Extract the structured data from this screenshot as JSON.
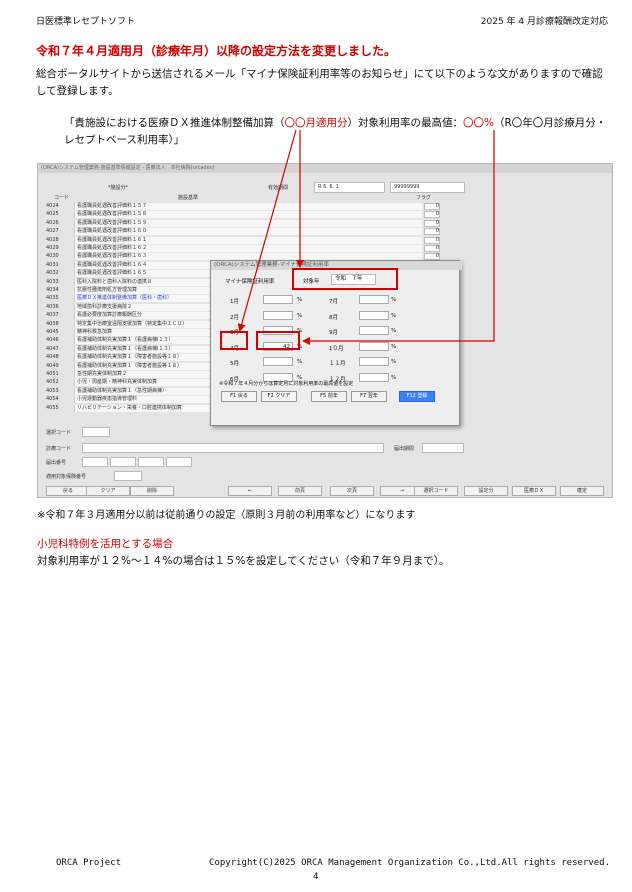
{
  "header": {
    "left": "日医標準レセプトソフト",
    "right": "2025 年 4 月診療報酬改定対応"
  },
  "heading": "令和７年４月適用月（診療年月）以降の設定方法を変更しました。",
  "intro": "総合ポータルサイトから送信されるメール「マイナ保険証利用率等のお知らせ」にて以下のような文がありますので確認して登録します。",
  "quote": {
    "part1": "「貴施設における医療ＤＸ推進体制整備加算（",
    "part2": "〇〇月適用分",
    "part3": "）対象利用率の最高値：",
    "part4": "〇〇%",
    "part5": "（R〇年〇月診療月分・レセプトベース利用率）」"
  },
  "screenshot": {
    "window_title": "(ORCA)システム管理業務-施設基準情報設定 - 医療法人　本社病院(orcadev)",
    "tab_label": "*施設分*",
    "col_code": "コード",
    "col_name": "施設基準",
    "col_flag": "フラグ",
    "valid_label": "有効期間",
    "valid_from": "R 6. 6. 1",
    "valid_sep": "～",
    "valid_to": "99999999",
    "rows": [
      {
        "code": "4024",
        "name": "看護職員処遇改善評価料１５７",
        "flag": "0"
      },
      {
        "code": "4025",
        "name": "看護職員処遇改善評価料１５８",
        "flag": "0"
      },
      {
        "code": "4026",
        "name": "看護職員処遇改善評価料１５９",
        "flag": "0"
      },
      {
        "code": "4027",
        "name": "看護職員処遇改善評価料１６０",
        "flag": "0"
      },
      {
        "code": "4028",
        "name": "看護職員処遇改善評価料１６１",
        "flag": "0"
      },
      {
        "code": "4029",
        "name": "看護職員処遇改善評価料１６２",
        "flag": "0"
      },
      {
        "code": "4030",
        "name": "看護職員処遇改善評価料１６３",
        "flag": "0"
      },
      {
        "code": "4031",
        "name": "看護職員処遇改善評価料１６４",
        "flag": "0"
      },
      {
        "code": "4032",
        "name": "看護職員処遇改善評価料１６５",
        "flag": "0"
      },
      {
        "code": "4033",
        "name": "医科入院料と歯科入院料の連携８",
        "flag": "0"
      },
      {
        "code": "4034",
        "name": "抗悪性腫瘍剤処方管理加算",
        "flag": "0"
      },
      {
        "code": "4035",
        "name": "医療ＤＸ推進体制整備加算（医科・歯科）",
        "flag": "0"
      },
      {
        "code": "4036",
        "name": "地域歯科診療支援病院２",
        "flag": "0"
      },
      {
        "code": "4037",
        "name": "看護必要度加算診療報酬区分",
        "flag": "0"
      },
      {
        "code": "4038",
        "name": "特定集中治療室遠隔支援加算（特定集中ＩＣＵ）",
        "flag": "0"
      },
      {
        "code": "4045",
        "name": "精神科救急加算",
        "flag": "0"
      },
      {
        "code": "4046",
        "name": "看護補助体制充実加算１（看護病棟Ⅰ１３）",
        "flag": "0"
      },
      {
        "code": "4047",
        "name": "看護補助体制充実加算１（看護病棟Ⅰ１３）",
        "flag": "0"
      },
      {
        "code": "4048",
        "name": "看護補助体制充実加算１（障害者施設等１８）",
        "flag": "0"
      },
      {
        "code": "4049",
        "name": "看護補助体制充実加算１（障害者施設等１８）",
        "flag": "0"
      },
      {
        "code": "4051",
        "name": "急性期充実体制加算２",
        "flag": "0"
      },
      {
        "code": "4052",
        "name": "小児・周産期・精神科充実体制加算",
        "flag": "0"
      },
      {
        "code": "4053",
        "name": "看護補助体制充実加算１（急性期病棟）",
        "flag": "0"
      },
      {
        "code": "4054",
        "name": "小児運動器疾患指導管理料",
        "flag": "0"
      },
      {
        "code": "4055",
        "name": "リハビリテーション・栄養・口腔連携体制加算",
        "flag": "0"
      }
    ],
    "select_code_label": "選択コード",
    "facility_code_label": "診療コード",
    "report_number_label": "届出番号",
    "report_date_label": "届出期間",
    "target_label": "適用対象保険番号",
    "bottom_buttons": [
      "戻る",
      "クリア",
      "削除",
      "",
      "←",
      "前頁",
      "次頁",
      "→",
      "",
      "選択コード",
      "設定分",
      "医療ＤＸ",
      "確定"
    ]
  },
  "dialog": {
    "title": "(ORCA)システム管理業務-マイナ保険証利用率",
    "rate_label": "マイナ保険証利用率",
    "year_label": "対象年",
    "year_value": "令和　７年",
    "left_months": [
      {
        "label": "1月",
        "value": ""
      },
      {
        "label": "2月",
        "value": ""
      },
      {
        "label": "3月",
        "value": ""
      },
      {
        "label": "4月",
        "value": "42"
      },
      {
        "label": "5月",
        "value": ""
      },
      {
        "label": "6月",
        "value": ""
      }
    ],
    "right_months": [
      {
        "label": "7月",
        "value": ""
      },
      {
        "label": "8月",
        "value": ""
      },
      {
        "label": "9月",
        "value": ""
      },
      {
        "label": "1０月",
        "value": ""
      },
      {
        "label": "１１月",
        "value": ""
      },
      {
        "label": "１２月",
        "value": ""
      }
    ],
    "pct": "%",
    "note": "※令和７年４月分からは算定月に対象利用率の最高値を設定",
    "buttons": [
      "F1 戻る",
      "F2 クリア",
      "F5 前年",
      "F7 翌年",
      "F12 登録"
    ]
  },
  "note_march": "※令和７年３月適用分以前は従前通りの設定（原則３月前の利用率など）になります",
  "pediatric_heading": "小児科特例を活用とする場合",
  "pediatric_text": "対象利用率が１２%～１４%の場合は１５%を設定してください（令和７年９月まで）。",
  "footer": {
    "left": "ORCA Project",
    "right": "Copyright(C)2025 ORCA Management Organization Co.,Ltd.All rights reserved.",
    "page": "4"
  },
  "colors": {
    "accent_red": "#d40000",
    "highlight_blue": "#3344cc",
    "register_button": "#3b82f6"
  }
}
